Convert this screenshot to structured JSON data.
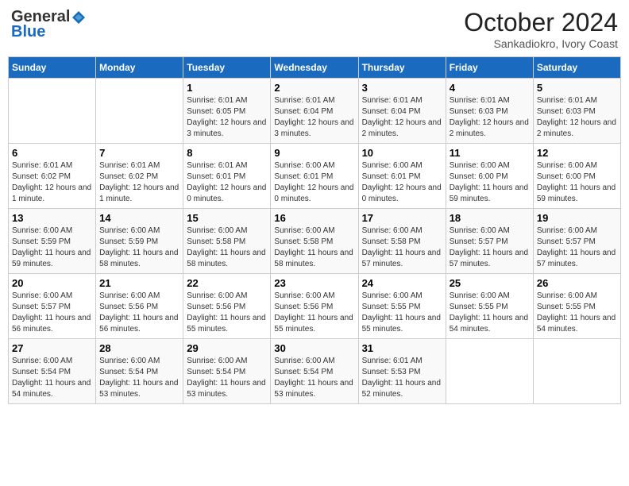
{
  "header": {
    "logo_general": "General",
    "logo_blue": "Blue",
    "month_title": "October 2024",
    "subtitle": "Sankadiokro, Ivory Coast"
  },
  "weekdays": [
    "Sunday",
    "Monday",
    "Tuesday",
    "Wednesday",
    "Thursday",
    "Friday",
    "Saturday"
  ],
  "weeks": [
    [
      {
        "day": "",
        "info": ""
      },
      {
        "day": "",
        "info": ""
      },
      {
        "day": "1",
        "info": "Sunrise: 6:01 AM\nSunset: 6:05 PM\nDaylight: 12 hours and 3 minutes."
      },
      {
        "day": "2",
        "info": "Sunrise: 6:01 AM\nSunset: 6:04 PM\nDaylight: 12 hours and 3 minutes."
      },
      {
        "day": "3",
        "info": "Sunrise: 6:01 AM\nSunset: 6:04 PM\nDaylight: 12 hours and 2 minutes."
      },
      {
        "day": "4",
        "info": "Sunrise: 6:01 AM\nSunset: 6:03 PM\nDaylight: 12 hours and 2 minutes."
      },
      {
        "day": "5",
        "info": "Sunrise: 6:01 AM\nSunset: 6:03 PM\nDaylight: 12 hours and 2 minutes."
      }
    ],
    [
      {
        "day": "6",
        "info": "Sunrise: 6:01 AM\nSunset: 6:02 PM\nDaylight: 12 hours and 1 minute."
      },
      {
        "day": "7",
        "info": "Sunrise: 6:01 AM\nSunset: 6:02 PM\nDaylight: 12 hours and 1 minute."
      },
      {
        "day": "8",
        "info": "Sunrise: 6:01 AM\nSunset: 6:01 PM\nDaylight: 12 hours and 0 minutes."
      },
      {
        "day": "9",
        "info": "Sunrise: 6:00 AM\nSunset: 6:01 PM\nDaylight: 12 hours and 0 minutes."
      },
      {
        "day": "10",
        "info": "Sunrise: 6:00 AM\nSunset: 6:01 PM\nDaylight: 12 hours and 0 minutes."
      },
      {
        "day": "11",
        "info": "Sunrise: 6:00 AM\nSunset: 6:00 PM\nDaylight: 11 hours and 59 minutes."
      },
      {
        "day": "12",
        "info": "Sunrise: 6:00 AM\nSunset: 6:00 PM\nDaylight: 11 hours and 59 minutes."
      }
    ],
    [
      {
        "day": "13",
        "info": "Sunrise: 6:00 AM\nSunset: 5:59 PM\nDaylight: 11 hours and 59 minutes."
      },
      {
        "day": "14",
        "info": "Sunrise: 6:00 AM\nSunset: 5:59 PM\nDaylight: 11 hours and 58 minutes."
      },
      {
        "day": "15",
        "info": "Sunrise: 6:00 AM\nSunset: 5:58 PM\nDaylight: 11 hours and 58 minutes."
      },
      {
        "day": "16",
        "info": "Sunrise: 6:00 AM\nSunset: 5:58 PM\nDaylight: 11 hours and 58 minutes."
      },
      {
        "day": "17",
        "info": "Sunrise: 6:00 AM\nSunset: 5:58 PM\nDaylight: 11 hours and 57 minutes."
      },
      {
        "day": "18",
        "info": "Sunrise: 6:00 AM\nSunset: 5:57 PM\nDaylight: 11 hours and 57 minutes."
      },
      {
        "day": "19",
        "info": "Sunrise: 6:00 AM\nSunset: 5:57 PM\nDaylight: 11 hours and 57 minutes."
      }
    ],
    [
      {
        "day": "20",
        "info": "Sunrise: 6:00 AM\nSunset: 5:57 PM\nDaylight: 11 hours and 56 minutes."
      },
      {
        "day": "21",
        "info": "Sunrise: 6:00 AM\nSunset: 5:56 PM\nDaylight: 11 hours and 56 minutes."
      },
      {
        "day": "22",
        "info": "Sunrise: 6:00 AM\nSunset: 5:56 PM\nDaylight: 11 hours and 55 minutes."
      },
      {
        "day": "23",
        "info": "Sunrise: 6:00 AM\nSunset: 5:56 PM\nDaylight: 11 hours and 55 minutes."
      },
      {
        "day": "24",
        "info": "Sunrise: 6:00 AM\nSunset: 5:55 PM\nDaylight: 11 hours and 55 minutes."
      },
      {
        "day": "25",
        "info": "Sunrise: 6:00 AM\nSunset: 5:55 PM\nDaylight: 11 hours and 54 minutes."
      },
      {
        "day": "26",
        "info": "Sunrise: 6:00 AM\nSunset: 5:55 PM\nDaylight: 11 hours and 54 minutes."
      }
    ],
    [
      {
        "day": "27",
        "info": "Sunrise: 6:00 AM\nSunset: 5:54 PM\nDaylight: 11 hours and 54 minutes."
      },
      {
        "day": "28",
        "info": "Sunrise: 6:00 AM\nSunset: 5:54 PM\nDaylight: 11 hours and 53 minutes."
      },
      {
        "day": "29",
        "info": "Sunrise: 6:00 AM\nSunset: 5:54 PM\nDaylight: 11 hours and 53 minutes."
      },
      {
        "day": "30",
        "info": "Sunrise: 6:00 AM\nSunset: 5:54 PM\nDaylight: 11 hours and 53 minutes."
      },
      {
        "day": "31",
        "info": "Sunrise: 6:01 AM\nSunset: 5:53 PM\nDaylight: 11 hours and 52 minutes."
      },
      {
        "day": "",
        "info": ""
      },
      {
        "day": "",
        "info": ""
      }
    ]
  ]
}
